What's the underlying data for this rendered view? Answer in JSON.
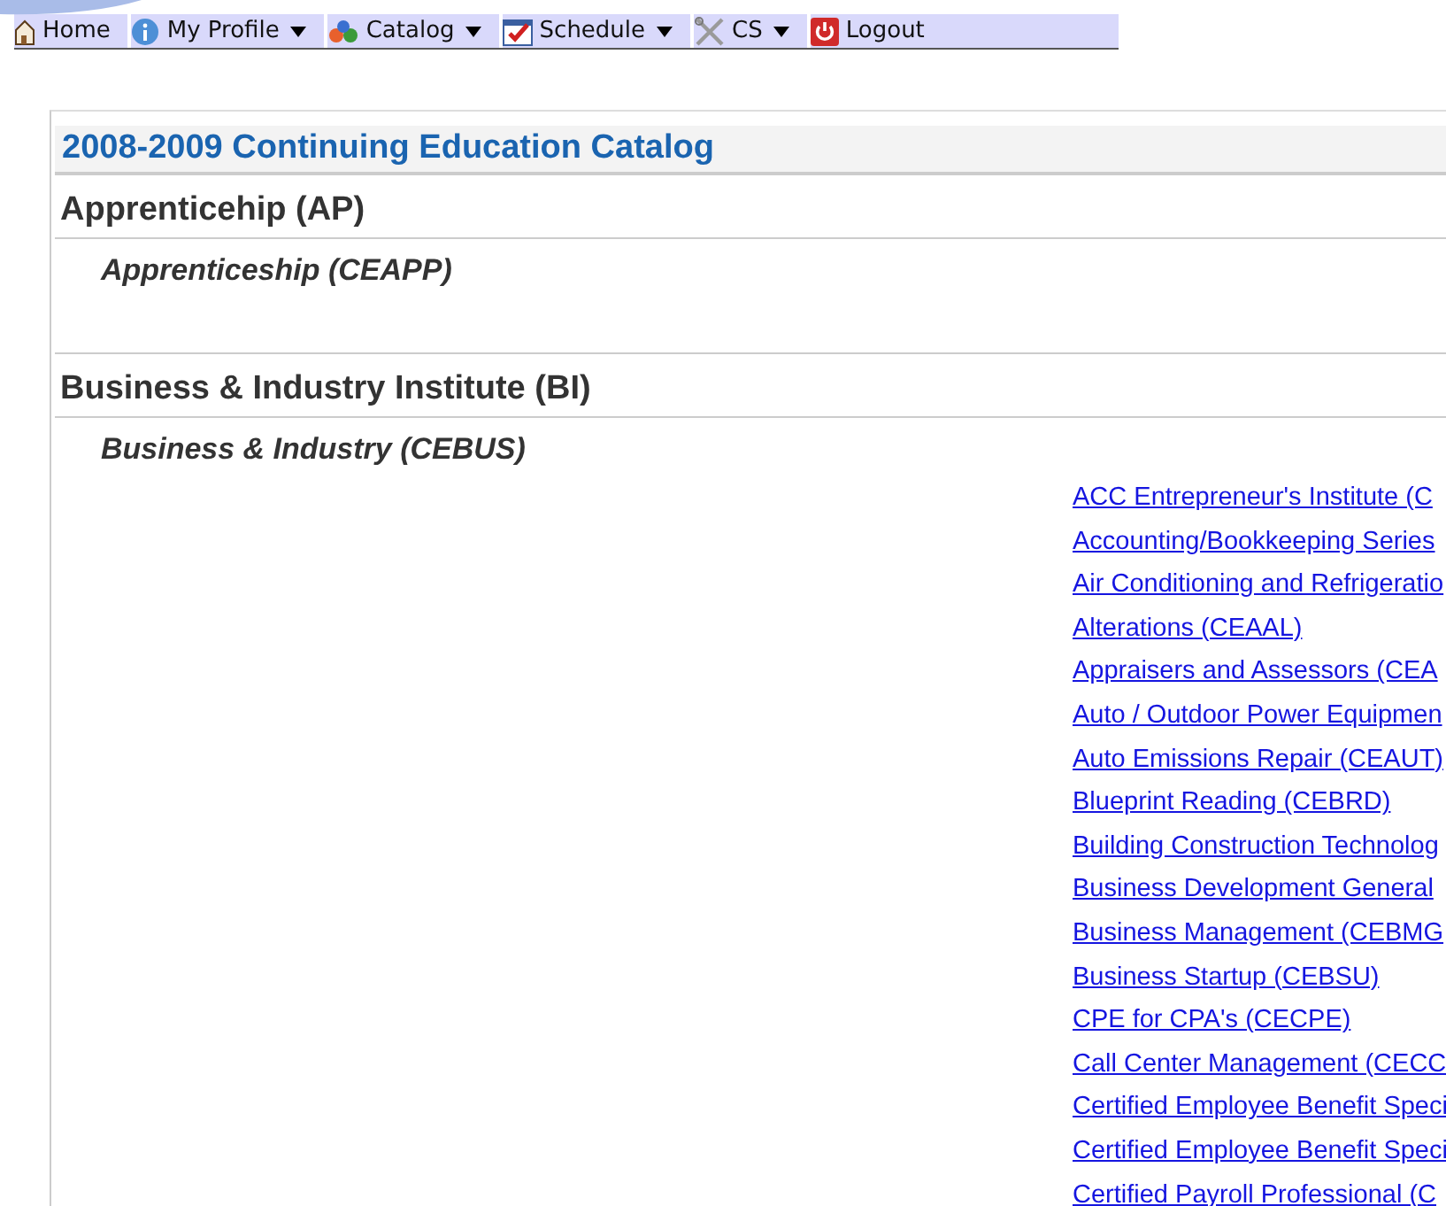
{
  "menu": [
    {
      "label": "Home",
      "dropdown": false
    },
    {
      "label": "My Profile",
      "dropdown": true
    },
    {
      "label": "Catalog",
      "dropdown": true
    },
    {
      "label": "Schedule",
      "dropdown": true
    },
    {
      "label": "CS",
      "dropdown": true
    },
    {
      "label": "Logout",
      "dropdown": false
    }
  ],
  "catalog": {
    "title": "2008-2009 Continuing Education Catalog",
    "sections": [
      {
        "title": "Apprenticehip (AP)",
        "subsections": [
          {
            "title": "Apprenticeship (CEAPP)"
          }
        ]
      },
      {
        "title": "Business & Industry Institute (BI)",
        "subsections": [
          {
            "title": "Business & Industry (CEBUS)",
            "links": [
              "ACC Entrepreneur's Institute (C",
              "Accounting/Bookkeeping Series",
              "Air Conditioning and Refrigeratio",
              "Alterations (CEAAL)",
              "Appraisers and Assessors (CEA",
              "Auto / Outdoor Power Equipmen",
              "Auto Emissions Repair (CEAUT)",
              "Blueprint Reading (CEBRD)",
              "Building Construction Technolog",
              "Business Development General",
              "Business Management (CEBMG",
              "Business Startup (CEBSU)",
              "CPE for CPA's (CECPE)",
              "Call Center Management (CECC",
              "Certified Employee Benefit Speci",
              "Certified Employee Benefit Speci",
              "Certified Payroll Professional (C"
            ]
          }
        ]
      }
    ]
  }
}
